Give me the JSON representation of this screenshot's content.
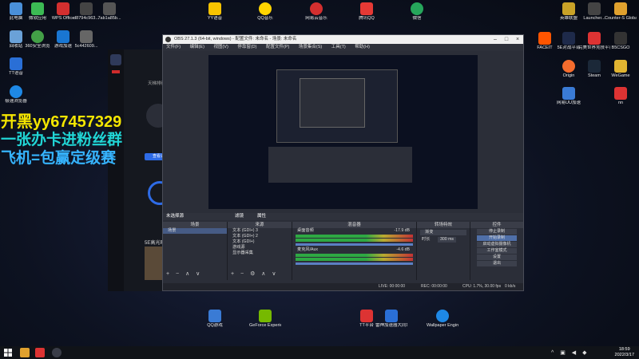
{
  "desktop_icons_left": [
    {
      "label": "此电脑",
      "color": "#4a90d9"
    },
    {
      "label": "回收站",
      "color": "#6aa1d8"
    },
    {
      "label": "TT语音",
      "color": "#2a6fd6"
    },
    {
      "label": "极速浏览器",
      "color": "#1e88e5"
    }
  ],
  "desktop_icons_top": [
    {
      "label": "微软应用",
      "color": "#3cba54"
    },
    {
      "label": "360安全浏览",
      "color": "#43a047"
    },
    {
      "label": "WPS Office",
      "color": "#d32f2f"
    },
    {
      "label": "游戏加速",
      "color": "#1976d2"
    },
    {
      "label": "d8794c963...",
      "color": "#444"
    },
    {
      "label": "7ab1a85b...",
      "color": "#555"
    },
    {
      "label": "5c442609...",
      "color": "#666"
    },
    {
      "label": "YY语音",
      "color": "#f7c300"
    },
    {
      "label": "QQ音乐",
      "color": "#ffd400"
    },
    {
      "label": "网易云音乐",
      "color": "#d32f2f"
    },
    {
      "label": "腾讯QQ",
      "color": "#e53935"
    },
    {
      "label": "微信",
      "color": "#26a65b"
    }
  ],
  "desktop_icons_right": [
    {
      "label": "英雄联盟",
      "color": "#c9a227"
    },
    {
      "label": "Launcher...",
      "color": "#444"
    },
    {
      "label": "Counter-S Global Off...",
      "color": "#e0a12e"
    },
    {
      "label": "FACEIT",
      "color": "#ff5500"
    },
    {
      "label": "5E对战平台",
      "color": "#1e2a4a"
    },
    {
      "label": "完美世界竞技平台",
      "color": "#d33"
    },
    {
      "label": "B5CSGO",
      "color": "#333"
    },
    {
      "label": "Origin",
      "color": "#f56c2d"
    },
    {
      "label": "Steam",
      "color": "#1b2838"
    },
    {
      "label": "WeGame",
      "color": "#e0b431"
    },
    {
      "label": "网易UU加速",
      "color": "#3a7bd5"
    },
    {
      "label": "nn",
      "color": "#d33"
    }
  ],
  "desktop_icons_bottom": [
    {
      "label": "QQ游戏",
      "color": "#3a7bd5"
    },
    {
      "label": "GeForce Experience",
      "color": "#76b900"
    },
    {
      "label": "TT平台",
      "color": "#d33"
    },
    {
      "label": "雷神加速器大同城平台",
      "color": "#2a6fd6"
    },
    {
      "label": "Wallpaper Engine:...",
      "color": "#1e88e5"
    }
  ],
  "obs": {
    "title": "OBS 27.1.3 (64-bit, windows) - 配置文件: 未命名 - 场景: 未命名",
    "menu": [
      "文件(F)",
      "编辑(E)",
      "视图(V)",
      "停靠窗(D)",
      "配置文件(P)",
      "场景集合(S)",
      "工具(T)",
      "帮助(H)"
    ],
    "scene_bar": {
      "label": "未选择源",
      "filter_btn": "滤镜",
      "props_btn": "属性"
    },
    "docks": {
      "scenes": {
        "title": "场景",
        "items": [
          "场景"
        ]
      },
      "sources": {
        "title": "来源",
        "items": [
          "文本 (GDI+) 3",
          "文本 (GDI+) 2",
          "文本 (GDI+)",
          "游戏源",
          "显示器采集"
        ]
      },
      "mixer": {
        "title": "混音器",
        "channels": [
          {
            "name": "桌面音频",
            "level": "-17.9 dB"
          },
          {
            "name": "麦克风/Aux",
            "level": "-4.6 dB"
          }
        ]
      },
      "transitions": {
        "title": "转场特效",
        "mode": "渐变",
        "duration_label": "时长",
        "duration_value": "300 ms"
      },
      "controls": {
        "title": "控件",
        "buttons": [
          "停止录制",
          "开始录制",
          "启动虚拟摄像机",
          "工作室模式",
          "设置",
          "退出"
        ]
      }
    },
    "status": {
      "live": "LIVE: 00:00:00",
      "rec": "REC: 00:00:00",
      "cpu": "CPU: 1.7%, 30.00 fps",
      "kbps": "0 kb/s"
    }
  },
  "overlay_text": {
    "line1": "开黑yy67457329",
    "line2": "一张办卡进粉丝群",
    "line3": "飞机=包赢定级赛",
    "line1_color": "#f5e600",
    "line2_color": "#21d6d6",
    "line3_color": "#36b4ff"
  },
  "bgapp": {
    "title": "5E高光时",
    "list_label": "天梯排行",
    "match_btn": "查看详细"
  },
  "taskbar": {
    "time": "18:59",
    "date": "2022/3/17"
  }
}
